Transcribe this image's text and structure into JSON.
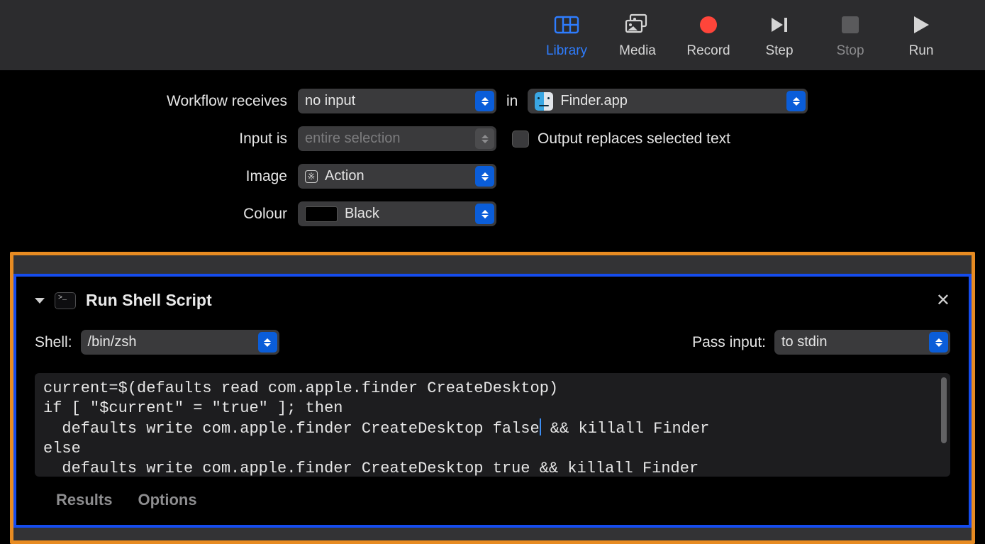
{
  "toolbar": {
    "library": "Library",
    "media": "Media",
    "record": "Record",
    "step": "Step",
    "stop": "Stop",
    "run": "Run"
  },
  "settings": {
    "workflow_receives_label": "Workflow receives",
    "workflow_receives_value": "no input",
    "in_label": "in",
    "app_value": "Finder.app",
    "input_is_label": "Input is",
    "input_is_value": "entire selection",
    "output_replaces_label": "Output replaces selected text",
    "image_label": "Image",
    "image_value": "Action",
    "colour_label": "Colour",
    "colour_value": "Black"
  },
  "action": {
    "title": "Run Shell Script",
    "shell_label": "Shell:",
    "shell_value": "/bin/zsh",
    "pass_input_label": "Pass input:",
    "pass_input_value": "to stdin",
    "script_pre": "current=$(defaults read com.apple.finder CreateDesktop)\nif [ \"$current\" = \"true\" ]; then\n  defaults write com.apple.finder CreateDesktop false",
    "script_post": " && killall Finder\nelse\n  defaults write com.apple.finder CreateDesktop true && killall Finder",
    "results_label": "Results",
    "options_label": "Options"
  }
}
